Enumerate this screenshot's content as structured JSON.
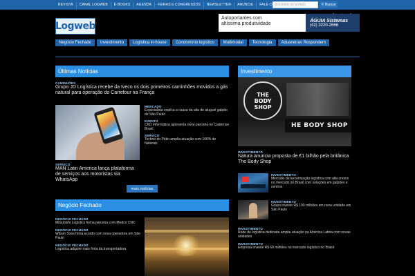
{
  "topbar": {
    "nav": [
      "REVISTA",
      "CANAL LOGWEB",
      "E-BOOKS",
      "AGENDA",
      "FEIRAS E CONGRESSOS",
      "NEWSLETTER",
      "ANUNCIE",
      "FALE CONOSCO"
    ],
    "search_placeholder": "Encontre no portal L",
    "search_button": "Buscar"
  },
  "header": {
    "logo": "Logweb",
    "social": [
      "f",
      "t",
      "in"
    ],
    "ad": {
      "line1": "Autoportantes com",
      "line2": "altíssima produtividade",
      "brand": "ÁGUIA Sistemas",
      "phone": "(42) 3220-2666"
    }
  },
  "mainnav": [
    "Negócio Fechado",
    "Investimento",
    "Logística in-house",
    "Condomínio logístico",
    "Multimodal",
    "Tecnologia",
    "Aduaneiras Respondem"
  ],
  "ultimas": {
    "title": "Últimas Notícias",
    "top_tag": "CAMINHÕES",
    "top_text": "Grupo JD Logística recebe da Iveco os dois primeiros caminhões movidos a gás natural para operação do Carrefour na França",
    "side_items": [
      {
        "tag": "MERCADO",
        "text": "Especialista explica a causa da alta do aluguel galpão de São Paulo"
      },
      {
        "tag": "EVENTO",
        "text": "CKD Informática apresenta nova parceria no Cadernos Brasil"
      },
      {
        "tag": "SERVIÇO",
        "text": "Techno do Pátio amplia atuação com 100% de Naturais"
      }
    ],
    "lead_tag": "SERVIÇO",
    "lead_text": "MAN Latin America lança plataforma de serviços aos motoristas via WhatsApp",
    "more_button": "mais notícias"
  },
  "negocio": {
    "title": "Negócio Fechado",
    "items": [
      {
        "tag": "NEGÓCIO FECHADO",
        "text": "Mitsubishi Logistics fecha parceria com Medco CNC"
      },
      {
        "tag": "NEGÓCIO FECHADO",
        "text": "Wilson Sons firma acordo com nova operadora em São Paulo"
      },
      {
        "tag": "NEGÓCIO FECHADO",
        "text": "Logística adquire mais frota da transportadora"
      }
    ]
  },
  "investimento": {
    "title": "Investimento",
    "shop_sign": [
      "THE",
      "BODY",
      "SHOP"
    ],
    "shop_banner": "HE BODY SHOP",
    "main_tag": "INVESTIMENTO",
    "main_text": "Natura anuncia proposta de €1 bilhão pela britânica The Body Shop",
    "thumb_items": [
      {
        "tag": "INVESTIMENTO",
        "text": "Mercado de terceirização logística com alta cresce no mercado do Brasil com soluções em galpões e centros"
      },
      {
        "tag": "INVESTIMENTO",
        "text": "Grupo investe R$ 100 milhões em nova unidade em São Paulo"
      }
    ],
    "list_items": [
      {
        "tag": "INVESTIMENTO",
        "text": "Rede de logística dedicada amplia atuação na América Latina com novas unidades"
      },
      {
        "tag": "INVESTIMENTO",
        "text": "Empresa investe R$ 60 milhões no mercado logístico no Brasil"
      }
    ]
  }
}
